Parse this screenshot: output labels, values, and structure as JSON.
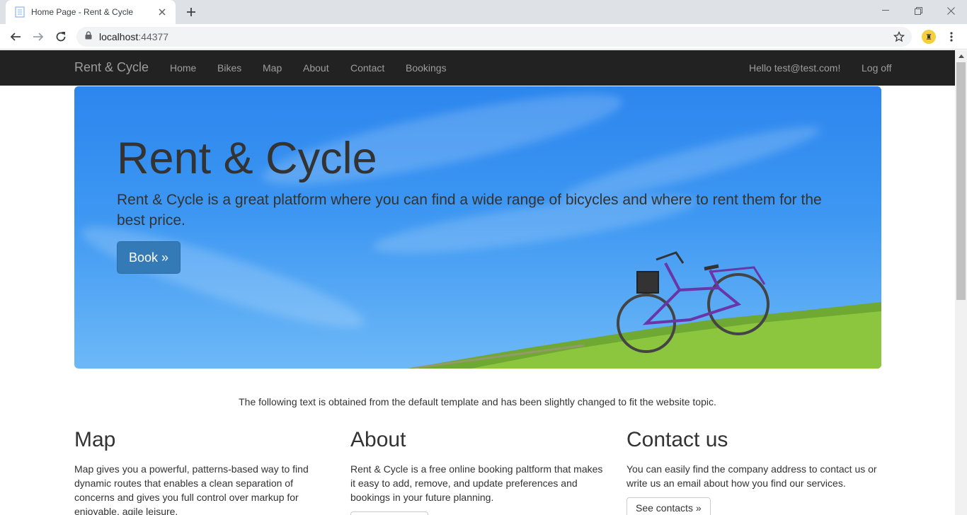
{
  "browser": {
    "tab_title": "Home Page - Rent & Cycle",
    "url_host": "localhost",
    "url_port": ":44377"
  },
  "navbar": {
    "brand": "Rent & Cycle",
    "links": [
      "Home",
      "Bikes",
      "Map",
      "About",
      "Contact",
      "Bookings"
    ],
    "greeting": "Hello test@test.com!",
    "logoff": "Log off"
  },
  "hero": {
    "title": "Rent & Cycle",
    "text": "Rent & Cycle is a great platform where you can find a wide range of bicycles and where to rent them for the best price.",
    "button": "Book »"
  },
  "note": "The following text is obtained from the default template and has been slightly changed to fit the website topic.",
  "columns": [
    {
      "heading": "Map",
      "text": "Map gives you a powerful, patterns-based way to find dynamic routes that enables a clean separation of concerns and gives you full control over markup for enjoyable, agile leisure."
    },
    {
      "heading": "About",
      "text": "Rent & Cycle is a free online booking paltform that makes it easy to add, remove, and update preferences and bookings in your future planning."
    },
    {
      "heading": "Contact us",
      "text": "You can easily find the company address to contact us or write us an email about how you find our services.",
      "button": "See contacts »"
    }
  ],
  "colors": {
    "navbar_bg": "#222222",
    "primary": "#337ab7",
    "sky": "#3d97f2",
    "grass": "#7bb23a"
  }
}
